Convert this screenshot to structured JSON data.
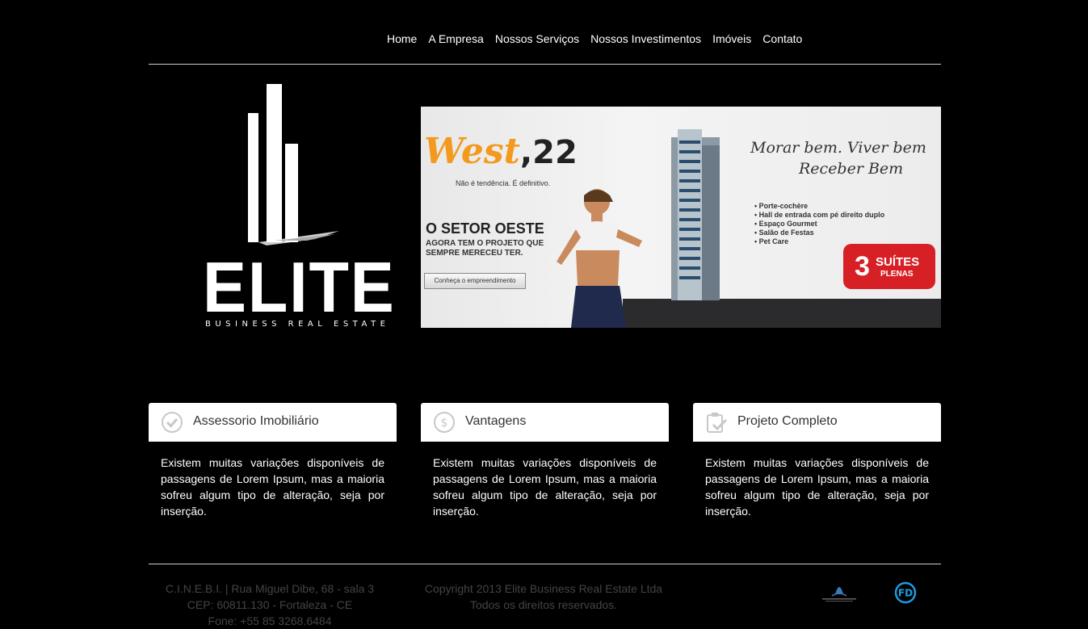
{
  "nav": {
    "items": [
      "Home",
      "A Empresa",
      "Nossos Serviços",
      "Nossos Investimentos",
      "Imóveis",
      "Contato"
    ]
  },
  "logo": {
    "text": "ELITE",
    "subtitle": "BUSINESS REAL ESTATE"
  },
  "banner": {
    "brand": "West",
    "brand_number": ",22",
    "tagline": "Não é tendência. É definitivo.",
    "headline": "O SETOR OESTE",
    "subline": "AGORA TEM O PROJETO QUE SEMPRE MERECEU TER.",
    "button": "Conheça o empreendimento",
    "slogan_line1": "Morar bem. Viver bem",
    "slogan_line2": "Receber Bem",
    "features": [
      "• Porte-cochère",
      "• Hall de entrada com pé direito duplo",
      "• Espaço Gourmet",
      "• Salão de Festas",
      "• Pet Care"
    ],
    "badge_number": "3",
    "badge_line1": "SUÍTES",
    "badge_line2": "PLENAS",
    "colors": {
      "brand_orange": "#f39a1e",
      "badge_red": "#d71f26"
    }
  },
  "cards": [
    {
      "icon": "check-circle-icon",
      "title": "Assessorio Imobiliário",
      "text": "Existem muitas variações disponíveis de passagens de Lorem Ipsum, mas a maioria sofreu algum tipo de alteração, seja por inserção."
    },
    {
      "icon": "dollar-circle-icon",
      "title": "Vantagens",
      "text": "Existem muitas variações disponíveis de passagens de Lorem Ipsum, mas a maioria sofreu algum tipo de alteração, seja por inserção."
    },
    {
      "icon": "clipboard-check-icon",
      "title": "Projeto Completo",
      "text": "Existem muitas variações disponíveis de passagens de Lorem Ipsum, mas a maioria sofreu algum tipo de alteração, seja por inserção."
    }
  ],
  "footer": {
    "address_line1": "C.I.N.E.B.I. | Rua Miguel Dibe, 68 - sala 3",
    "address_line2": "CEP: 60811.130 - Fortaleza - CE",
    "address_line3": "Fone: +55 85 3268.6484",
    "copyright_line1": "Copyright 2013 Elite Business Real Estate Ltda",
    "copyright_line2": "Todos os direitos reservados.",
    "fd_logo_text": "FD"
  }
}
